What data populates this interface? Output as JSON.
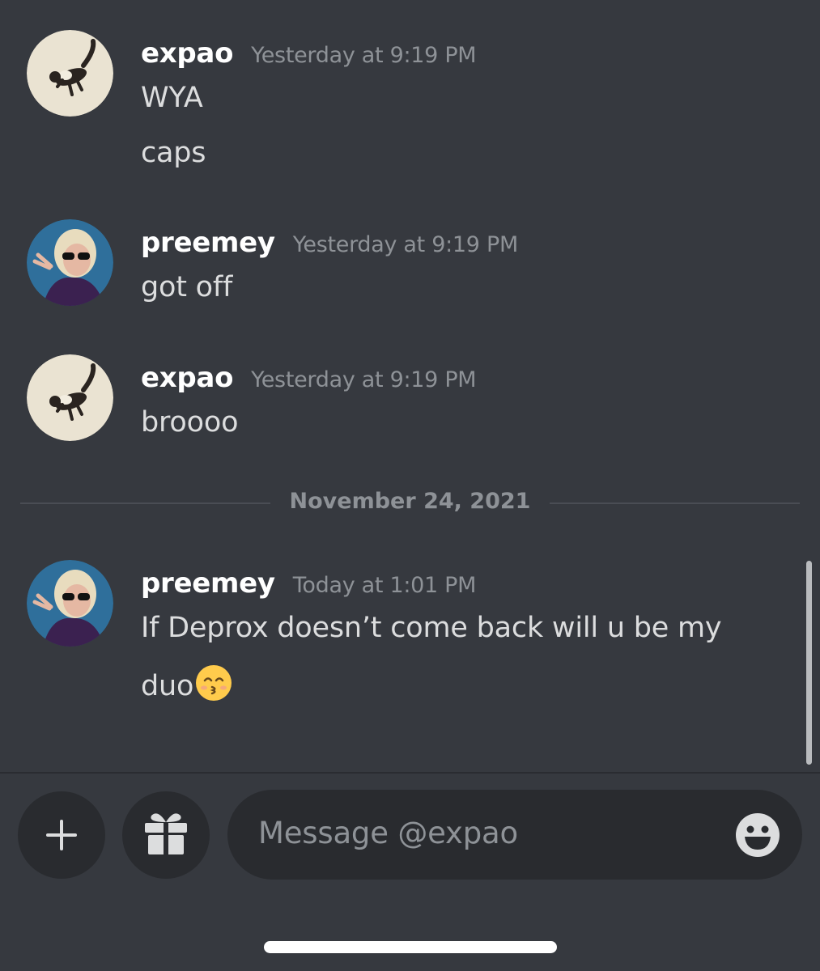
{
  "messages": [
    {
      "avatar": "ferret-avatar",
      "username": "expao",
      "timestamp": "Yesterday at 9:19 PM",
      "lines": [
        "WYA",
        "caps"
      ]
    },
    {
      "avatar": "sunglasses-avatar",
      "username": "preemey",
      "timestamp": "Yesterday at 9:19 PM",
      "lines": [
        "got off"
      ]
    },
    {
      "avatar": "ferret-avatar",
      "username": "expao",
      "timestamp": "Yesterday at 9:19 PM",
      "lines": [
        "broooo"
      ]
    },
    {
      "avatar": "sunglasses-avatar",
      "username": "preemey",
      "timestamp": "Today at 1:01 PM",
      "lines": [
        "If Deprox doesn’t come back will u be my",
        "duo"
      ],
      "emoji": "kissing-face-smiling-eyes-emoji"
    }
  ],
  "date_divider": "November 24, 2021",
  "composer": {
    "placeholder": "Message @expao",
    "icons": [
      "plus-icon",
      "gift-icon",
      "emoji-icon"
    ]
  },
  "colors": {
    "background": "#36393f",
    "input_background": "#292b2f",
    "username": "#ffffff",
    "message_text": "#dcddde",
    "muted_text": "#8e9297"
  }
}
